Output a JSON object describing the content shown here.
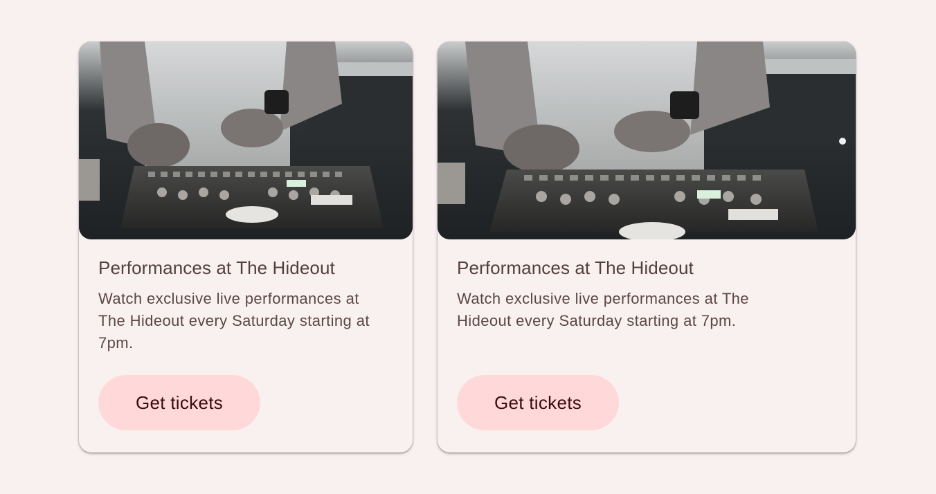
{
  "cards": [
    {
      "title": "Performances at The Hideout",
      "description": "Watch exclusive live performances at The Hideout every Saturday starting at 7pm.",
      "button_label": "Get tickets",
      "image_icon": "dj-mixer-photo"
    },
    {
      "title": "Performances at The Hideout",
      "description": "Watch exclusive live performances at The Hideout every Saturday starting at 7pm.",
      "button_label": "Get tickets",
      "image_icon": "dj-mixer-photo"
    }
  ],
  "colors": {
    "background": "#f9f1f0",
    "title": "#52403f",
    "body_text": "#5a4746",
    "button_bg": "#ffd9d9",
    "button_text": "#3b0a0e"
  }
}
